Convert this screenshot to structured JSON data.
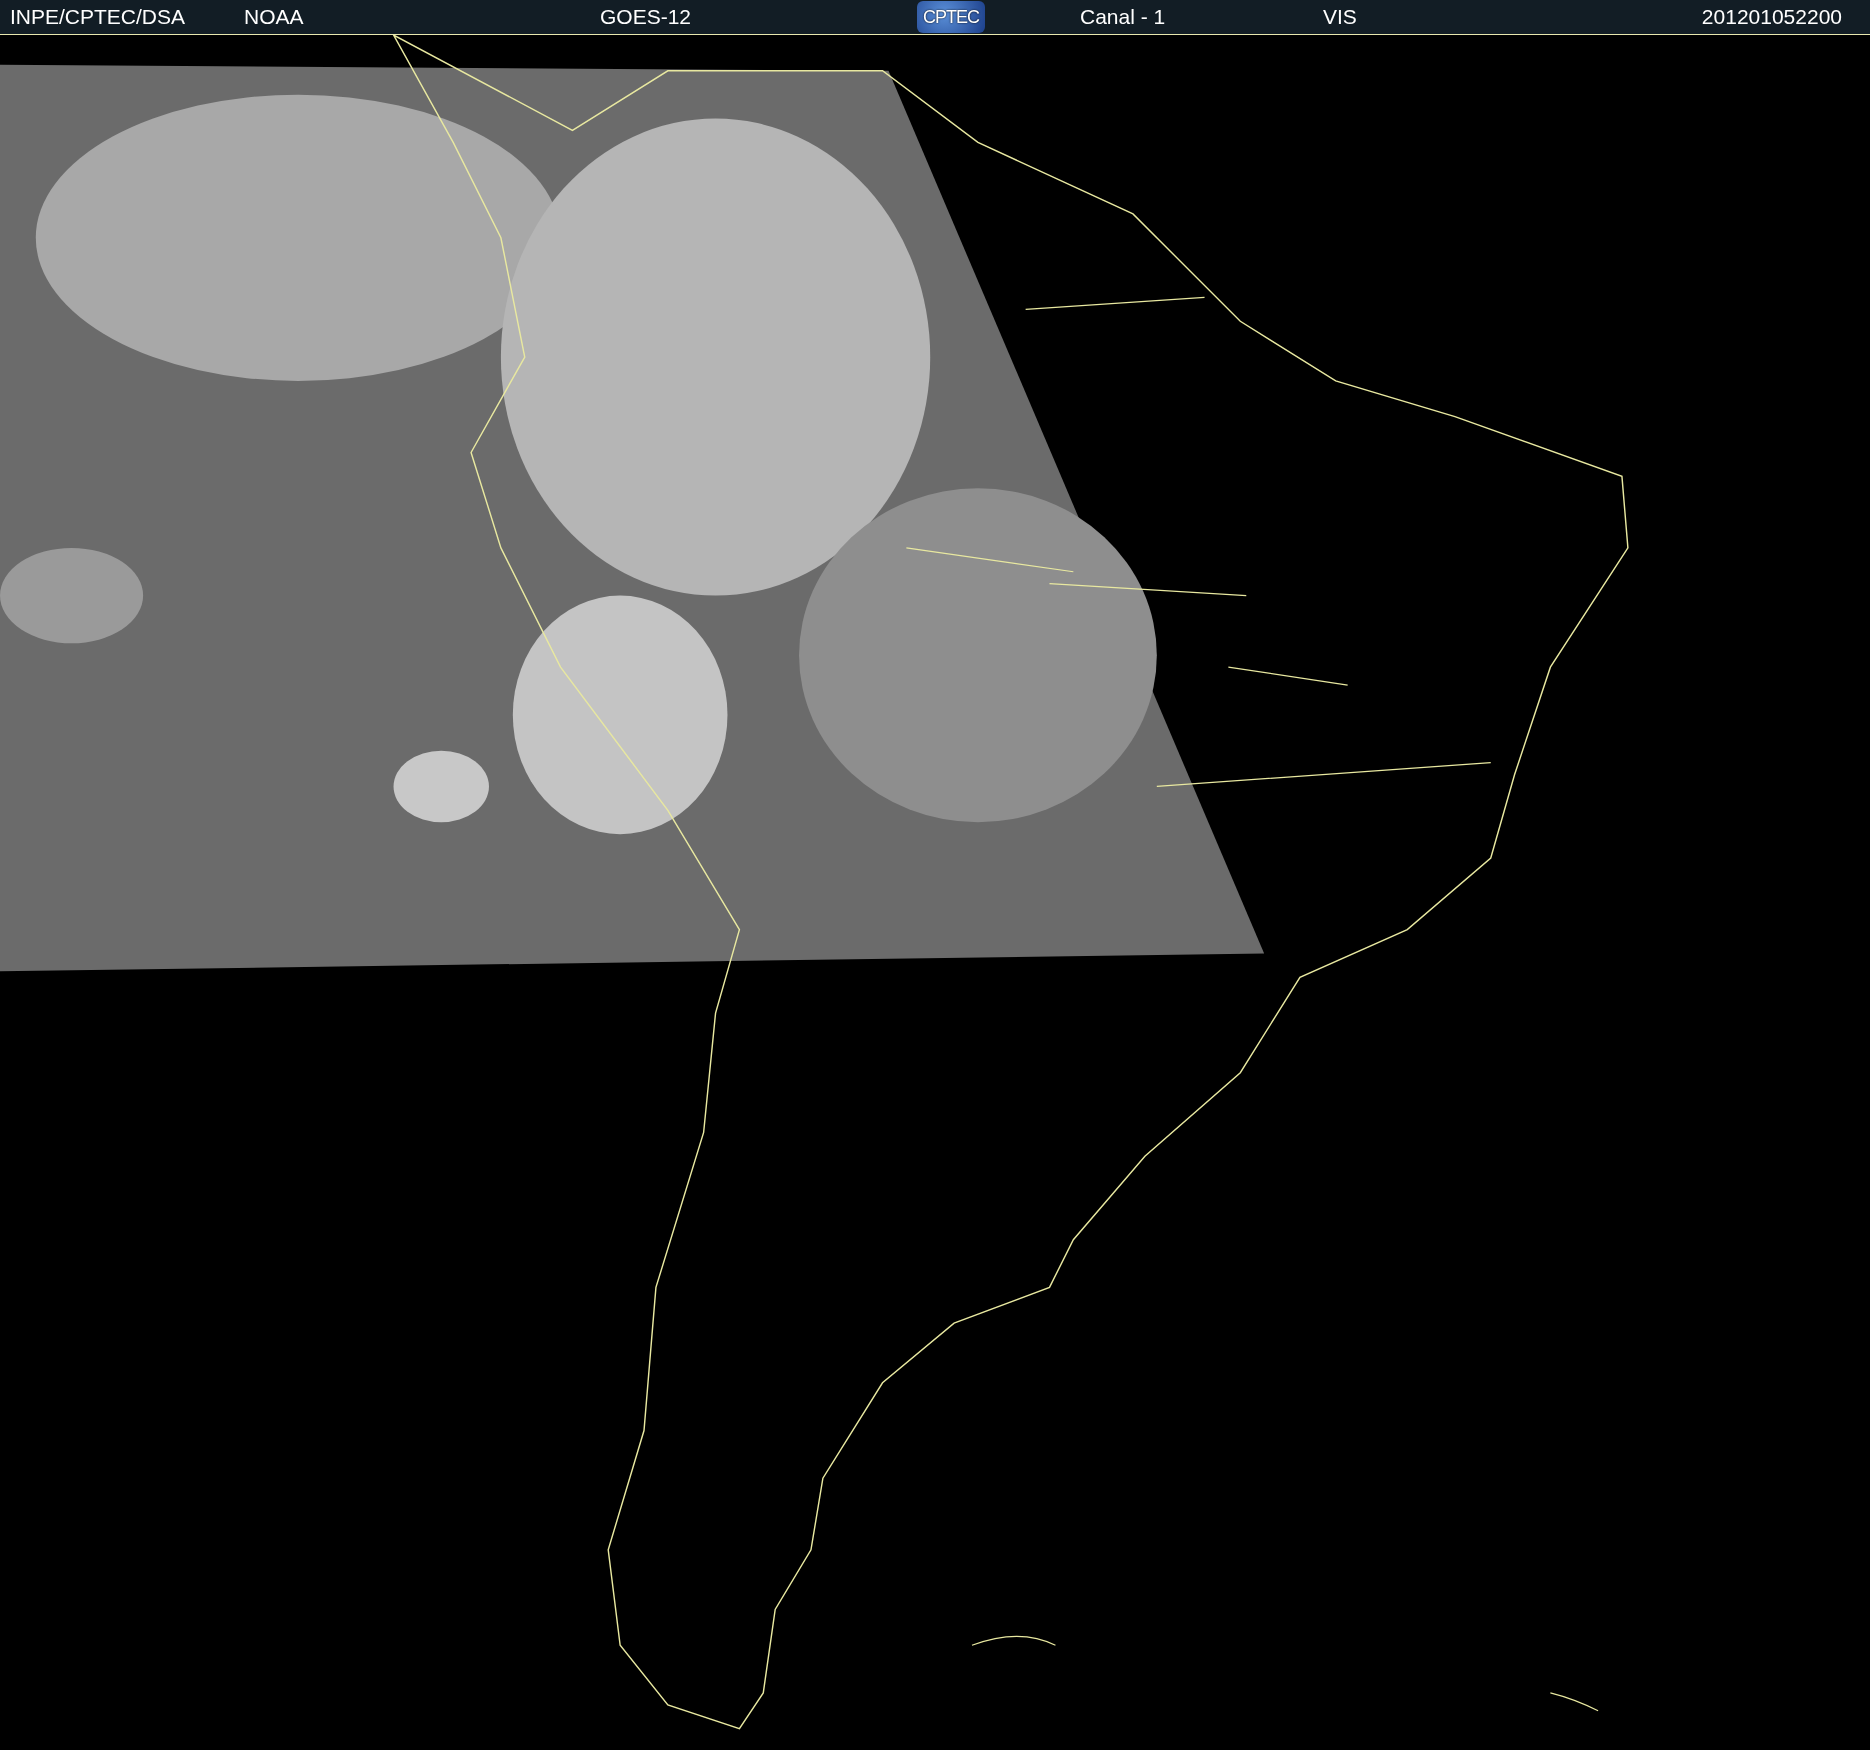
{
  "header": {
    "source": "INPE/CPTEC/DSA",
    "agency": "NOAA",
    "satellite": "GOES-12",
    "logo": "CPTEC",
    "channel": "Canal - 1",
    "band": "VIS",
    "timestamp": "201201052200"
  }
}
